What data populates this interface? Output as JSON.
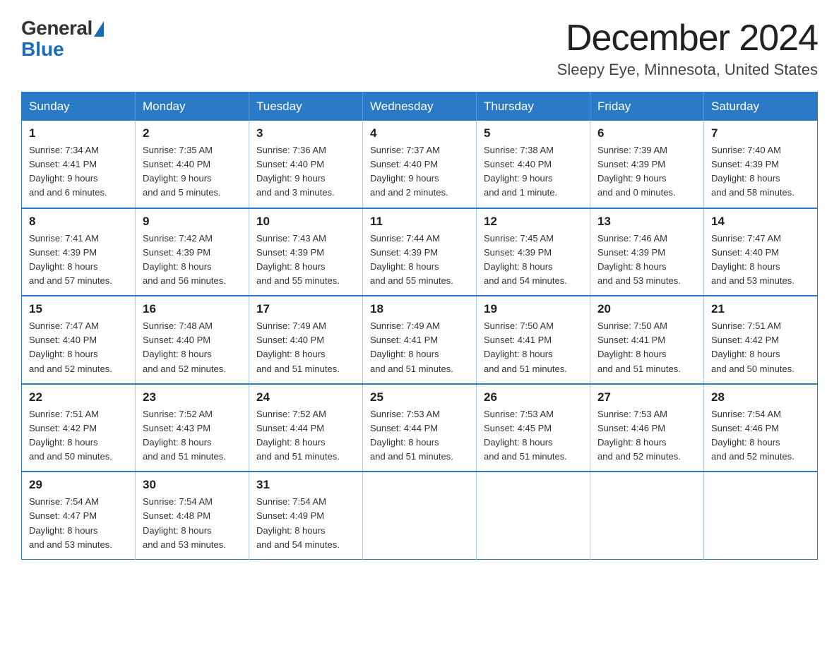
{
  "logo": {
    "general": "General",
    "blue": "Blue"
  },
  "title": "December 2024",
  "subtitle": "Sleepy Eye, Minnesota, United States",
  "headers": [
    "Sunday",
    "Monday",
    "Tuesday",
    "Wednesday",
    "Thursday",
    "Friday",
    "Saturday"
  ],
  "weeks": [
    [
      {
        "day": "1",
        "sunrise": "7:34 AM",
        "sunset": "4:41 PM",
        "daylight": "9 hours and 6 minutes."
      },
      {
        "day": "2",
        "sunrise": "7:35 AM",
        "sunset": "4:40 PM",
        "daylight": "9 hours and 5 minutes."
      },
      {
        "day": "3",
        "sunrise": "7:36 AM",
        "sunset": "4:40 PM",
        "daylight": "9 hours and 3 minutes."
      },
      {
        "day": "4",
        "sunrise": "7:37 AM",
        "sunset": "4:40 PM",
        "daylight": "9 hours and 2 minutes."
      },
      {
        "day": "5",
        "sunrise": "7:38 AM",
        "sunset": "4:40 PM",
        "daylight": "9 hours and 1 minute."
      },
      {
        "day": "6",
        "sunrise": "7:39 AM",
        "sunset": "4:39 PM",
        "daylight": "9 hours and 0 minutes."
      },
      {
        "day": "7",
        "sunrise": "7:40 AM",
        "sunset": "4:39 PM",
        "daylight": "8 hours and 58 minutes."
      }
    ],
    [
      {
        "day": "8",
        "sunrise": "7:41 AM",
        "sunset": "4:39 PM",
        "daylight": "8 hours and 57 minutes."
      },
      {
        "day": "9",
        "sunrise": "7:42 AM",
        "sunset": "4:39 PM",
        "daylight": "8 hours and 56 minutes."
      },
      {
        "day": "10",
        "sunrise": "7:43 AM",
        "sunset": "4:39 PM",
        "daylight": "8 hours and 55 minutes."
      },
      {
        "day": "11",
        "sunrise": "7:44 AM",
        "sunset": "4:39 PM",
        "daylight": "8 hours and 55 minutes."
      },
      {
        "day": "12",
        "sunrise": "7:45 AM",
        "sunset": "4:39 PM",
        "daylight": "8 hours and 54 minutes."
      },
      {
        "day": "13",
        "sunrise": "7:46 AM",
        "sunset": "4:39 PM",
        "daylight": "8 hours and 53 minutes."
      },
      {
        "day": "14",
        "sunrise": "7:47 AM",
        "sunset": "4:40 PM",
        "daylight": "8 hours and 53 minutes."
      }
    ],
    [
      {
        "day": "15",
        "sunrise": "7:47 AM",
        "sunset": "4:40 PM",
        "daylight": "8 hours and 52 minutes."
      },
      {
        "day": "16",
        "sunrise": "7:48 AM",
        "sunset": "4:40 PM",
        "daylight": "8 hours and 52 minutes."
      },
      {
        "day": "17",
        "sunrise": "7:49 AM",
        "sunset": "4:40 PM",
        "daylight": "8 hours and 51 minutes."
      },
      {
        "day": "18",
        "sunrise": "7:49 AM",
        "sunset": "4:41 PM",
        "daylight": "8 hours and 51 minutes."
      },
      {
        "day": "19",
        "sunrise": "7:50 AM",
        "sunset": "4:41 PM",
        "daylight": "8 hours and 51 minutes."
      },
      {
        "day": "20",
        "sunrise": "7:50 AM",
        "sunset": "4:41 PM",
        "daylight": "8 hours and 51 minutes."
      },
      {
        "day": "21",
        "sunrise": "7:51 AM",
        "sunset": "4:42 PM",
        "daylight": "8 hours and 50 minutes."
      }
    ],
    [
      {
        "day": "22",
        "sunrise": "7:51 AM",
        "sunset": "4:42 PM",
        "daylight": "8 hours and 50 minutes."
      },
      {
        "day": "23",
        "sunrise": "7:52 AM",
        "sunset": "4:43 PM",
        "daylight": "8 hours and 51 minutes."
      },
      {
        "day": "24",
        "sunrise": "7:52 AM",
        "sunset": "4:44 PM",
        "daylight": "8 hours and 51 minutes."
      },
      {
        "day": "25",
        "sunrise": "7:53 AM",
        "sunset": "4:44 PM",
        "daylight": "8 hours and 51 minutes."
      },
      {
        "day": "26",
        "sunrise": "7:53 AM",
        "sunset": "4:45 PM",
        "daylight": "8 hours and 51 minutes."
      },
      {
        "day": "27",
        "sunrise": "7:53 AM",
        "sunset": "4:46 PM",
        "daylight": "8 hours and 52 minutes."
      },
      {
        "day": "28",
        "sunrise": "7:54 AM",
        "sunset": "4:46 PM",
        "daylight": "8 hours and 52 minutes."
      }
    ],
    [
      {
        "day": "29",
        "sunrise": "7:54 AM",
        "sunset": "4:47 PM",
        "daylight": "8 hours and 53 minutes."
      },
      {
        "day": "30",
        "sunrise": "7:54 AM",
        "sunset": "4:48 PM",
        "daylight": "8 hours and 53 minutes."
      },
      {
        "day": "31",
        "sunrise": "7:54 AM",
        "sunset": "4:49 PM",
        "daylight": "8 hours and 54 minutes."
      },
      null,
      null,
      null,
      null
    ]
  ],
  "labels": {
    "sunrise": "Sunrise:",
    "sunset": "Sunset:",
    "daylight": "Daylight:"
  }
}
